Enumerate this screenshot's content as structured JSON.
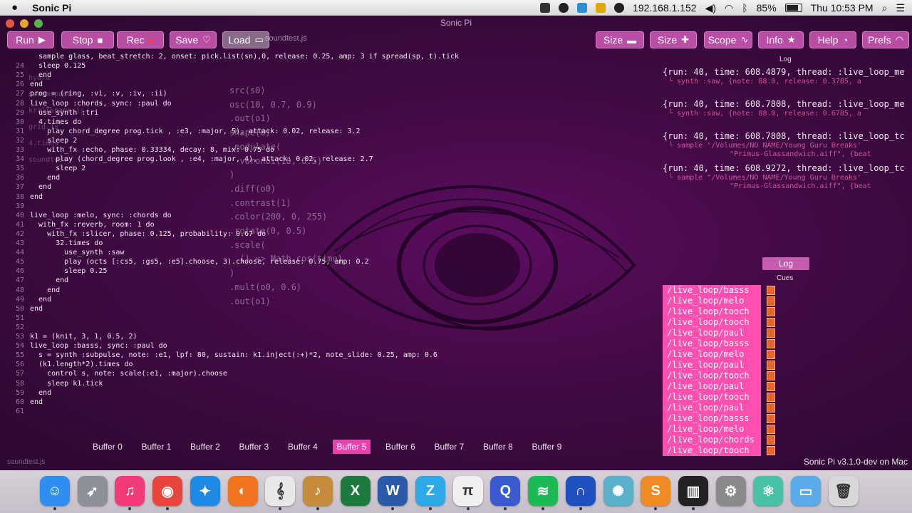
{
  "menubar": {
    "app_name": "Sonic Pi",
    "ip": "192.168.1.152",
    "battery": "85%",
    "clock": "Thu 10:53 PM"
  },
  "window": {
    "title": "Sonic Pi"
  },
  "toolbar": {
    "run": "Run",
    "stop": "Stop",
    "rec": "Rec",
    "save": "Save",
    "load": "Load",
    "load_file": "soundtest.js",
    "size1": "Size",
    "size2": "Size",
    "scope": "Scope",
    "info": "Info",
    "help": "Help",
    "prefs": "Prefs"
  },
  "editor": {
    "lines": [
      {
        "n": "",
        "t": "  sample glass, beat_stretch: 2, onset: pick.list(sn),0, release: 0.25, amp: 3 if spread(sp, t).tick"
      },
      {
        "n": "24",
        "t": "  sleep 0.125"
      },
      {
        "n": "25",
        "t": "  end"
      },
      {
        "n": "26",
        "t": "end"
      },
      {
        "n": "27",
        "t": "prog = (ring, :vi, :v, :iv, :ii)"
      },
      {
        "n": "28",
        "t": "live_loop :chords, sync: :paul do"
      },
      {
        "n": "29",
        "t": "  use_synth :tri"
      },
      {
        "n": "30",
        "t": "  4.times do"
      },
      {
        "n": "31",
        "t": "    play chord_degree prog.tick , :e3, :major, 5), attack: 0.02, release: 3.2"
      },
      {
        "n": "32",
        "t": "    sleep 2"
      },
      {
        "n": "33",
        "t": "    with_fx :echo, phase: 0.33334, decay: 8, mix: 0.75 do"
      },
      {
        "n": "34",
        "t": "      play (chord_degree prog.look , :e4, :major, 4), attack: 0.02, release: 2.7"
      },
      {
        "n": "35",
        "t": "      sleep 2"
      },
      {
        "n": "36",
        "t": "    end"
      },
      {
        "n": "37",
        "t": "  end"
      },
      {
        "n": "38",
        "t": "end"
      },
      {
        "n": "39",
        "t": ""
      },
      {
        "n": "40",
        "t": "live_loop :melo, sync: :chords do"
      },
      {
        "n": "41",
        "t": "  with_fx :reverb, room: 1 do"
      },
      {
        "n": "42",
        "t": "    with_fx :slicer, phase: 0.125, probability: 0.67 do"
      },
      {
        "n": "43",
        "t": "      32.times do"
      },
      {
        "n": "44",
        "t": "        use_synth :saw"
      },
      {
        "n": "45",
        "t": "        play (octs [:cs5, :gs5, :e5].choose, 3).choose, release: 0.75, amp: 0.2"
      },
      {
        "n": "46",
        "t": "        sleep 0.25"
      },
      {
        "n": "47",
        "t": "      end"
      },
      {
        "n": "48",
        "t": "    end"
      },
      {
        "n": "49",
        "t": "  end"
      },
      {
        "n": "50",
        "t": "end"
      },
      {
        "n": "51",
        "t": ""
      },
      {
        "n": "52",
        "t": ""
      },
      {
        "n": "53",
        "t": "k1 = (knit, 3, 1, 0.5, 2)"
      },
      {
        "n": "54",
        "t": "live_loop :basss, sync: :paul do"
      },
      {
        "n": "55",
        "t": "  s = synth :subpulse, note: :e1, lpf: 80, sustain: k1.inject(:+)*2, note_slide: 0.25, amp: 0.6"
      },
      {
        "n": "56",
        "t": "  (k1.length*2).times do"
      },
      {
        "n": "57",
        "t": "    control s, note: scale(:e1, :major).choose"
      },
      {
        "n": "58",
        "t": "    sleep k1.tick"
      },
      {
        "n": "59",
        "t": "  end"
      },
      {
        "n": "60",
        "t": "end"
      },
      {
        "n": "61",
        "t": ""
      }
    ],
    "hydra": [
      "src(s0)",
      "osc(10, 0.7, 0.9)",
      ".out(o1)",
      "shape(6)",
      ".modulate(",
      "  voronoi(10, 0.5)",
      ")",
      ".diff(o0)",
      ".contrast(1)",
      ".color(200, 0, 255)",
      ".rotate(0, 0.5)",
      ".scale(",
      "  () => Math.cos(time)",
      ")",
      ".mult(o0, 0.6)",
      ".out(o1)"
    ],
    "ghost_files": [
      "hydra",
      "swarmspace",
      "krallspace.js",
      "grid.js",
      "4.times",
      "soundtest"
    ]
  },
  "log": {
    "label": "Log",
    "entries": [
      {
        "head": "{run: 40, time: 608.4879, thread: :live_loop_me",
        "sub": "synth :saw, {note: 88.0, release: 0.3785, a"
      },
      {
        "head": "{run: 40, time: 608.7808, thread: :live_loop_me",
        "sub": "synth :saw, {note: 88.0, release: 0.6785, a"
      },
      {
        "head": "{run: 40, time: 608.7808, thread: :live_loop_tc",
        "sub": "sample \"/Volumes/NO NAME/Young Guru Breaks'",
        "sub2": "\"Primus-Glassandwich.aiff\", {beat"
      },
      {
        "head": "{run: 40, time: 608.9272, thread: :live_loop_tc",
        "sub": "sample \"/Volumes/NO NAME/Young Guru Breaks'",
        "sub2": "\"Primus-Glassandwich.aiff\", {beat"
      }
    ]
  },
  "log_tab": "Log",
  "cues_label": "Cues",
  "cues": [
    "/live_loop/basss",
    "/live_loop/melo",
    "/live_loop/tooch",
    "/live_loop/tooch",
    "/live_loop/paul",
    "/live_loop/basss",
    "/live_loop/melo",
    "/live_loop/paul",
    "/live_loop/tooch",
    "/live_loop/paul",
    "/live_loop/tooch",
    "/live_loop/paul",
    "/live_loop/basss",
    "/live_loop/melo",
    "/live_loop/chords",
    "/live_loop/tooch"
  ],
  "buffers": [
    "Buffer 0",
    "Buffer 1",
    "Buffer 2",
    "Buffer 3",
    "Buffer 4",
    "Buffer 5",
    "Buffer 6",
    "Buffer 7",
    "Buffer 8",
    "Buffer 9"
  ],
  "active_buffer": 5,
  "status": {
    "left": "soundtest.js",
    "version": "Sonic Pi v3.1.0-dev on Mac"
  },
  "dock": [
    {
      "name": "finder-icon",
      "color": "#2f8ff0",
      "glyph": "☺"
    },
    {
      "name": "launchpad-icon",
      "color": "#8d8f99",
      "glyph": "➶"
    },
    {
      "name": "itunes-icon",
      "color": "#f33a78",
      "glyph": "♫"
    },
    {
      "name": "chrome-icon",
      "color": "#e8453c",
      "glyph": "◉"
    },
    {
      "name": "safari-icon",
      "color": "#1f8ae6",
      "glyph": "✦"
    },
    {
      "name": "firefox-icon",
      "color": "#f2731d",
      "glyph": "◐"
    },
    {
      "name": "sonic-pi-icon",
      "color": "#e8e8e8",
      "glyph": "𝄞"
    },
    {
      "name": "instruments-icon",
      "color": "#c78b3c",
      "glyph": "♪"
    },
    {
      "name": "excel-icon",
      "color": "#1d7a3e",
      "glyph": "X"
    },
    {
      "name": "word-icon",
      "color": "#2b5aa9",
      "glyph": "W"
    },
    {
      "name": "text-editor-icon",
      "color": "#2fa8e8",
      "glyph": "Z"
    },
    {
      "name": "pi-icon",
      "color": "#f0f0f0",
      "glyph": "π"
    },
    {
      "name": "quicktime-icon",
      "color": "#3a5bd0",
      "glyph": "Q"
    },
    {
      "name": "spotify-icon",
      "color": "#1db954",
      "glyph": "≋"
    },
    {
      "name": "audacity-icon",
      "color": "#2050c0",
      "glyph": "∩"
    },
    {
      "name": "atom-icon",
      "color": "#5ab0c8",
      "glyph": "✺"
    },
    {
      "name": "sublime-icon",
      "color": "#f08a24",
      "glyph": "S"
    },
    {
      "name": "piano-icon",
      "color": "#222222",
      "glyph": "▥"
    },
    {
      "name": "system-preferences-icon",
      "color": "#8a8a8a",
      "glyph": "⚙"
    },
    {
      "name": "electron-icon",
      "color": "#47c2a6",
      "glyph": "⚛"
    },
    {
      "name": "folder-icon",
      "color": "#5aa9e8",
      "glyph": "▭"
    },
    {
      "name": "trash-icon",
      "color": "#d8d8d8",
      "glyph": "🗑"
    }
  ]
}
